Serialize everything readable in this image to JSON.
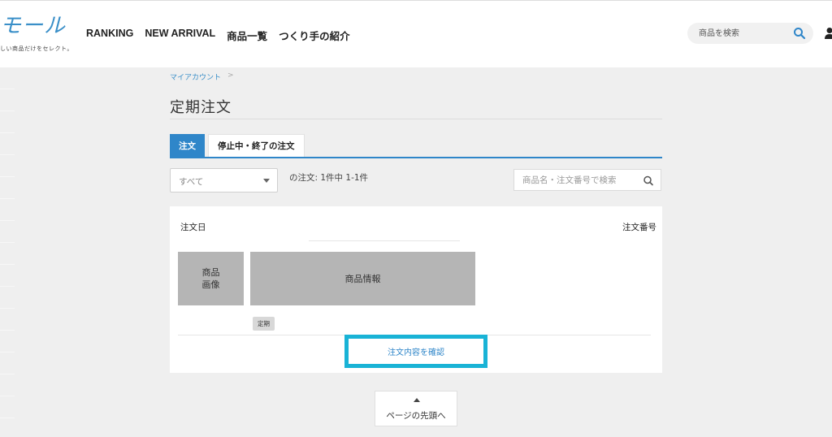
{
  "header": {
    "logo_text": "モール",
    "logo_sub": "しい商品だけをセレクト。",
    "nav": [
      {
        "label": "RANKING"
      },
      {
        "label": "NEW ARRIVAL"
      },
      {
        "label": "商品一覧"
      },
      {
        "label": "つくり手の紹介"
      }
    ],
    "search_placeholder": "商品を検索",
    "search_icon": "search-icon",
    "user_icon": "user-icon"
  },
  "breadcrumb": {
    "items": [
      "マイアカウント"
    ],
    "separator": ">"
  },
  "page": {
    "title": "定期注文"
  },
  "tabs": [
    {
      "label": "注文",
      "active": true
    },
    {
      "label": "停止中・終了の注文",
      "active": false
    }
  ],
  "filter": {
    "select_value": "すべて",
    "count_text": "の注文: 1件中 1-1件",
    "search_placeholder": "商品名・注文番号で検索"
  },
  "order": {
    "date_label": "注文日",
    "number_label": "注文番号",
    "image_placeholder": "商品\n画像",
    "info_placeholder": "商品情報",
    "badge": "定期",
    "confirm_label": "注文内容を確認"
  },
  "footer": {
    "to_top_label": "ページの先頭へ"
  },
  "colors": {
    "accent": "#2f86c9",
    "highlight": "#19b3d6",
    "background": "#efefef"
  }
}
